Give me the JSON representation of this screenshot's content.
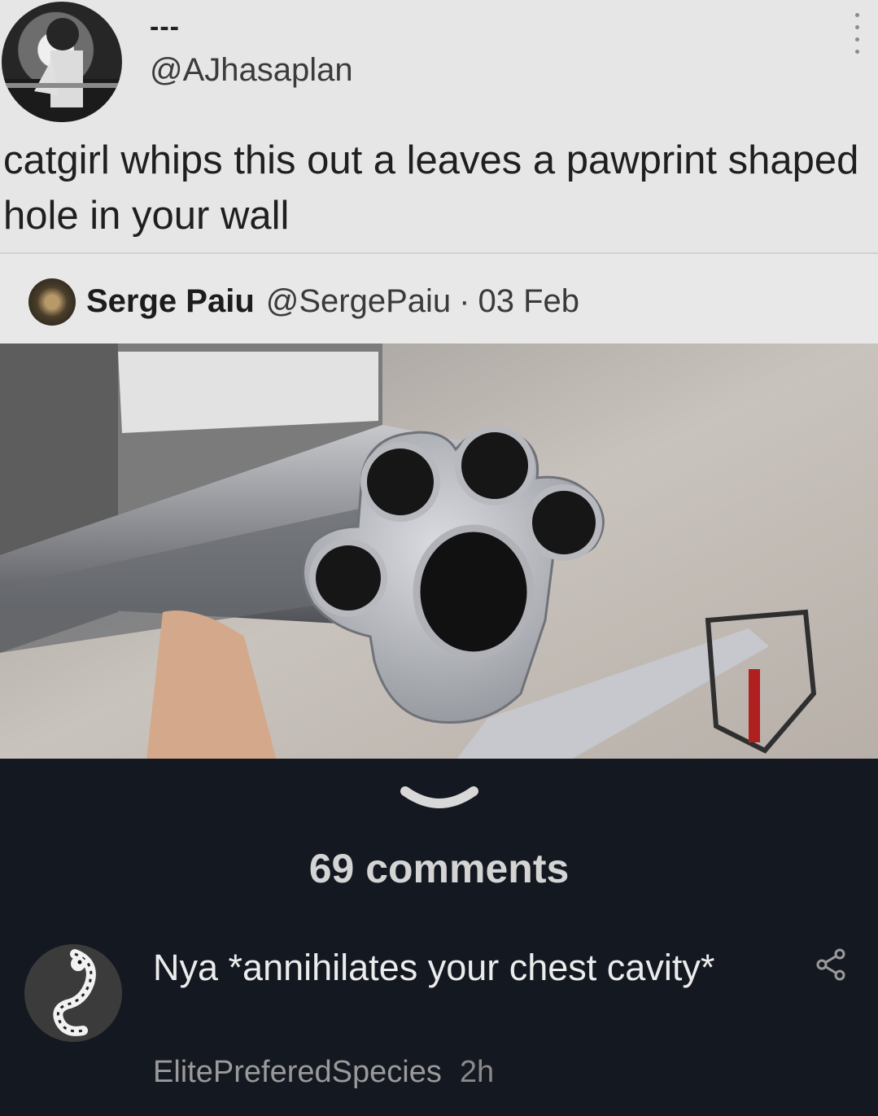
{
  "tweet": {
    "display_name": "---",
    "handle": "@AJhasaplan",
    "text": "catgirl whips this out a leaves a pawprint shaped hole in your wall",
    "quote": {
      "name": "Serge Paiu",
      "handle": "@SergePaiu",
      "separator": "·",
      "date": "03 Feb"
    }
  },
  "comments": {
    "count_label": "69 comments",
    "items": [
      {
        "text": "Nya *annihilates your chest cavity*",
        "author": "ElitePreferedSpecies",
        "time": "2h"
      }
    ]
  },
  "icons": {
    "more": "more-vertical-icon",
    "expand": "chevron-down-icon",
    "share": "share-icon"
  },
  "colors": {
    "tweet_background": "#e6e6e6",
    "app_background": "#141821",
    "comment_text": "#ececec"
  }
}
